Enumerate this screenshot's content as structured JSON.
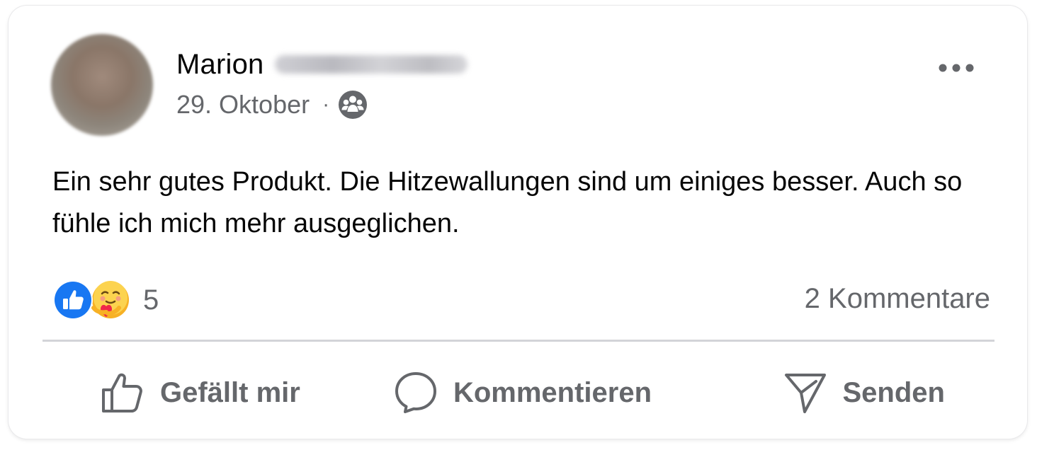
{
  "post": {
    "author_name": "Marion",
    "date": "29. Oktober",
    "separator": "·",
    "audience_icon": "group-icon",
    "more_icon": "more-options-icon",
    "text": "Ein sehr gutes Produkt. Die Hitzewallungen sind um einiges besser. Auch so fühle ich mich mehr ausgeglichen."
  },
  "reactions": {
    "icons": [
      "like-reaction-icon",
      "care-reaction-icon"
    ],
    "count": "5"
  },
  "comments": {
    "count_label": "2 Kommentare"
  },
  "actions": {
    "like_label": "Gefällt mir",
    "comment_label": "Kommentieren",
    "share_label": "Senden"
  },
  "colors": {
    "text_primary": "#050505",
    "text_secondary": "#65676b",
    "like_blue": "#1877f2",
    "divider": "#d3d4d8"
  }
}
